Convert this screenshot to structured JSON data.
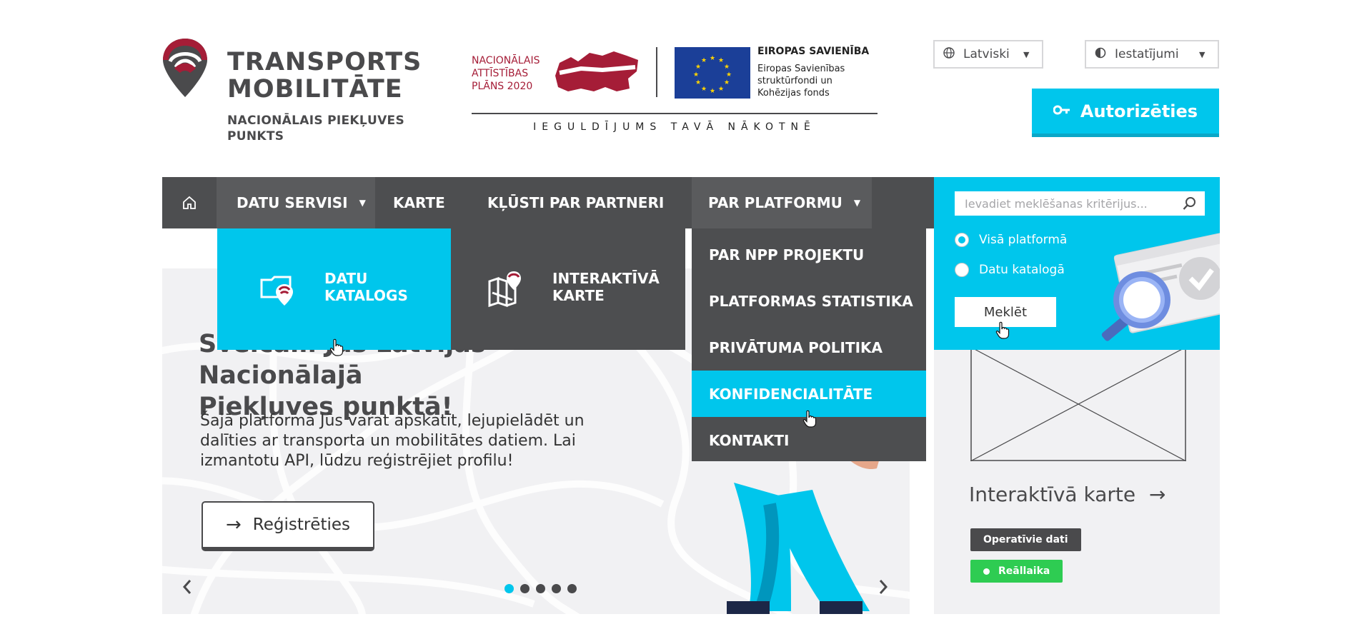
{
  "header": {
    "brand_title_line1": "TRANSPORTS",
    "brand_title_line2": "MOBILITĀTE",
    "brand_subtitle_line1": "NACIONĀLAIS PIEKĻUVES",
    "brand_subtitle_line2": "PUNKTS",
    "nap_line1": "NACIONĀLAIS",
    "nap_line2": "ATTĪSTĪBAS",
    "nap_line3": "PLĀNS 2020",
    "eu_title": "EIROPAS SAVIENĪBA",
    "eu_line1": "Eiropas Savienības",
    "eu_line2": "struktūrfondi un",
    "eu_line3": "Kohēzijas fonds",
    "invest_text": "IEGULDĪJUMS TAVĀ NĀKOTNĒ",
    "language_select": "Latviski",
    "settings_select": "Iestatījumi",
    "auth_button": "Autorizēties"
  },
  "nav": {
    "items": [
      {
        "label": "DATU SERVISI",
        "has_caret": true
      },
      {
        "label": "KARTE"
      },
      {
        "label": "KĻŪSTI PAR PARTNERI"
      },
      {
        "label": "PAR PLATFORMU",
        "has_caret": true
      }
    ]
  },
  "dropdowns": {
    "data_services": [
      {
        "line1": "DATU",
        "line2": "KATALOGS"
      },
      {
        "line1": "INTERAKTĪVĀ",
        "line2": "KARTE"
      }
    ],
    "platform": [
      {
        "label": "PAR NPP PROJEKTU"
      },
      {
        "label": "PLATFORMAS STATISTIKA"
      },
      {
        "label": "PRIVĀTUMA POLITIKA"
      },
      {
        "label": "KONFIDENCIALITĀTE",
        "active": true
      },
      {
        "label": "KONTAKTI"
      }
    ]
  },
  "hero": {
    "title_line1": "Sveicam Jūs Latvijas Nacionālajā",
    "title_line2": "Piekļuves punktā!",
    "body": "Šajā platformā Jūs varat apskatīt, lejupielādēt un dalīties ar transporta un mobilitātes datiem. Lai izmantotu API, lūdzu reģistrējiet profilu!",
    "register_button": "Reģistrēties",
    "slides": 5,
    "active_slide": 1
  },
  "search": {
    "placeholder": "Ievadiet meklēšanas kritērijus...",
    "options": [
      {
        "label": "Visā platformā",
        "checked": true
      },
      {
        "label": "Datu katalogā",
        "checked": false
      }
    ],
    "button": "Meklēt"
  },
  "side_card": {
    "title": "Interaktīvā karte",
    "badge_operative": "Operatīvie dati",
    "badge_realtime": "Reāllaika"
  },
  "colors": {
    "accent": "#00c6ec",
    "nav_bg": "#4d4e50",
    "brand_red": "#a51d37",
    "live_green": "#2ecc52"
  }
}
